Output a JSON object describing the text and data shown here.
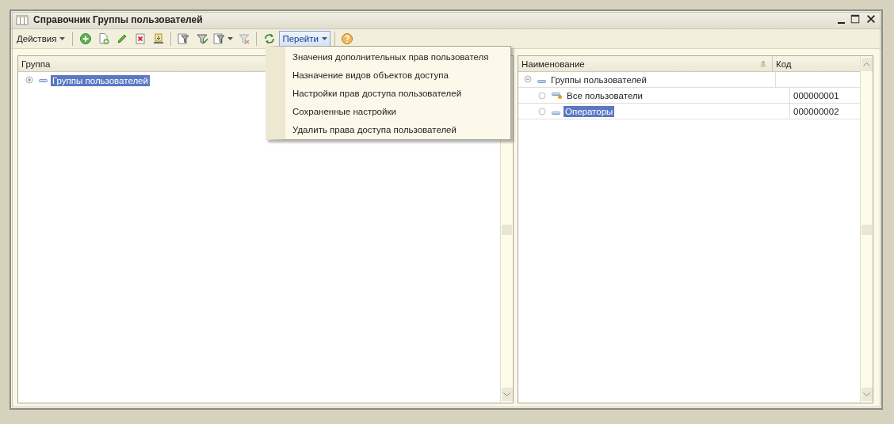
{
  "window": {
    "title": "Справочник Группы пользователей"
  },
  "toolbar": {
    "actions": {
      "label": "Действия"
    },
    "goto": {
      "label": "Перейти",
      "open": true
    }
  },
  "goto_menu": [
    "Значения дополнительных прав пользователя",
    "Назначение видов объектов доступа",
    "Настройки прав доступа пользователей",
    "Сохраненные настройки",
    "Удалить права доступа пользователей"
  ],
  "left_panel": {
    "column": "Группа",
    "tree": [
      {
        "label": "Группы пользователей",
        "expanded": false,
        "selected": true
      }
    ]
  },
  "right_panel": {
    "columns": [
      "Наименование",
      "Код"
    ],
    "rows": [
      {
        "name": "Группы пользователей",
        "expanded": true,
        "selected": false,
        "predefined": false,
        "children": [
          {
            "name": "Все пользователи",
            "code": "000000001",
            "selected": false,
            "predefined": true
          },
          {
            "name": "Операторы",
            "code": "000000002",
            "selected": true,
            "predefined": false
          }
        ]
      }
    ]
  }
}
